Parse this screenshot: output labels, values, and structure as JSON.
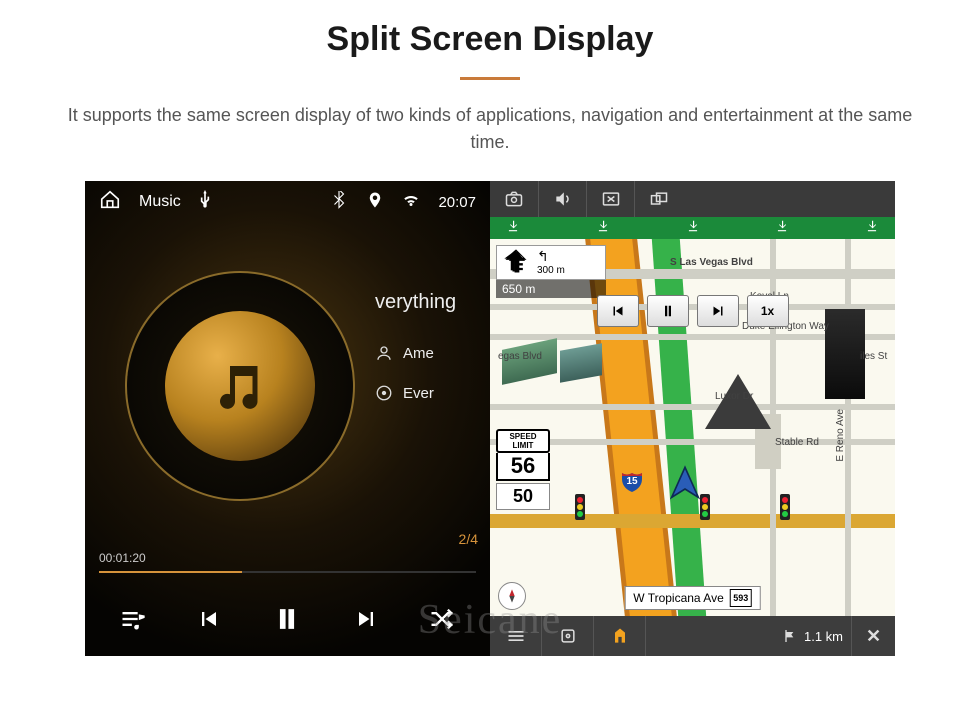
{
  "header": {
    "title": "Split Screen Display",
    "desc": "It supports the same screen display of two kinds of applications, navigation and entertainment at the same time."
  },
  "watermark": "Seicane",
  "music": {
    "app_label": "Music",
    "status_time": "20:07",
    "now_playing": "verything",
    "artist": "Ame",
    "album": "Ever",
    "track_index": "2/4",
    "elapsed": "00:01:20",
    "total": ""
  },
  "nav": {
    "turn": {
      "dir_label": "",
      "small_dist": "300 m",
      "big_dist": "650 m"
    },
    "transport": {
      "speed_label": "1x"
    },
    "speed": {
      "limit_label": "SPEED LIMIT",
      "limit": "56",
      "current": "50"
    },
    "streets": {
      "top": "S Las Vegas Blvd",
      "koval": "Koval Ln",
      "duke": "Duke Ellington Way",
      "egas": "egas Blvd",
      "iles": "iles St",
      "luxor": "Luxor Dr",
      "reno": "E Reno Ave",
      "stable": "Stable Rd",
      "tropicana": "W Tropicana Ave"
    },
    "shields": {
      "i15": "15",
      "r593": "593"
    },
    "bottom": {
      "alt": "—",
      "dist": "1.1 km",
      "close": "✕"
    }
  }
}
